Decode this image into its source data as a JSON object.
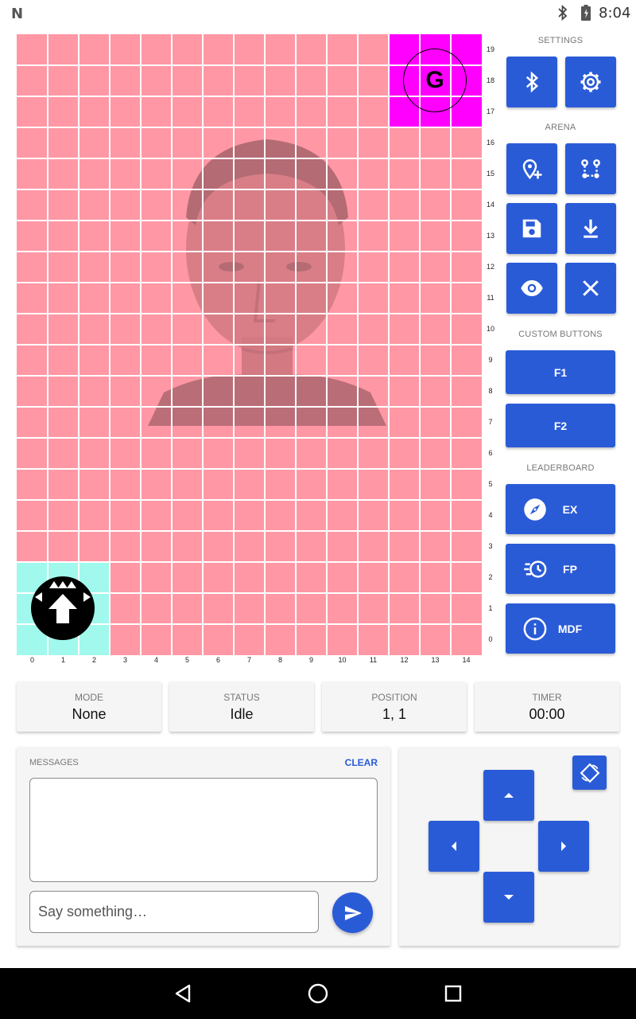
{
  "status_bar": {
    "logo": "N",
    "time": "8:04"
  },
  "arena": {
    "x_labels": [
      "0",
      "1",
      "2",
      "3",
      "4",
      "5",
      "6",
      "7",
      "8",
      "9",
      "10",
      "11",
      "12",
      "13",
      "14"
    ],
    "y_labels": [
      "19",
      "18",
      "17",
      "16",
      "15",
      "14",
      "13",
      "12",
      "11",
      "10",
      "9",
      "8",
      "7",
      "6",
      "5",
      "4",
      "3",
      "2",
      "1",
      "0"
    ],
    "goal_label": "G",
    "colors": {
      "cell": "#ff97a5",
      "start": "#a0f9ec",
      "goal": "#ff00ff",
      "grid": "#ffffff"
    }
  },
  "side_panel": {
    "settings_label": "SETTINGS",
    "arena_label": "ARENA",
    "custom_buttons_label": "CUSTOM BUTTONS",
    "leaderboard_label": "LEADERBOARD",
    "f1_label": "F1",
    "f2_label": "F2",
    "ex_label": "EX",
    "fp_label": "FP",
    "mdf_label": "MDF",
    "accent": "#2a5bd7"
  },
  "info_cards": {
    "mode": {
      "label": "MODE",
      "value": "None"
    },
    "status": {
      "label": "STATUS",
      "value": "Idle"
    },
    "position": {
      "label": "POSITION",
      "value": "1, 1"
    },
    "timer": {
      "label": "TIMER",
      "value": "00:00"
    }
  },
  "messages": {
    "label": "MESSAGES",
    "clear_label": "CLEAR",
    "input_placeholder": "Say something…"
  }
}
